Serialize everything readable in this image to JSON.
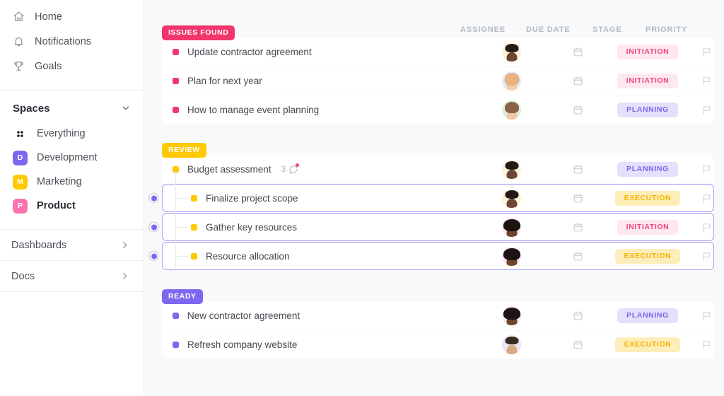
{
  "sidebar": {
    "nav": [
      {
        "label": "Home",
        "icon": "home-icon"
      },
      {
        "label": "Notifications",
        "icon": "bell-icon"
      },
      {
        "label": "Goals",
        "icon": "trophy-icon"
      }
    ],
    "spaces_header": {
      "label": "Spaces",
      "icon": "chevron-down-icon"
    },
    "spaces": [
      {
        "label": "Everything",
        "icon": "grid-dots-icon",
        "initial": "",
        "color": ""
      },
      {
        "label": "Development",
        "icon": "space-avatar",
        "initial": "D",
        "color": "#7b68ee"
      },
      {
        "label": "Marketing",
        "icon": "space-avatar",
        "initial": "M",
        "color": "#ffc800"
      },
      {
        "label": "Product",
        "icon": "space-avatar",
        "initial": "P",
        "color": "#fd71af",
        "active": true
      }
    ],
    "sections": [
      {
        "label": "Dashboards",
        "icon": "chevron-right-icon"
      },
      {
        "label": "Docs",
        "icon": "chevron-right-icon"
      }
    ]
  },
  "columns": {
    "assignee": "ASSIGNEE",
    "due_date": "DUE DATE",
    "stage": "STAGE",
    "priority": "PRIORITY"
  },
  "stage_colors": {
    "INITIATION": {
      "bg": "#fde8ef",
      "fg": "#f0467f"
    },
    "PLANNING": {
      "bg": "#e3e0fb",
      "fg": "#7b68ee"
    },
    "EXECUTION": {
      "bg": "#fdeeb9",
      "fg": "#f5b400"
    }
  },
  "groups": [
    {
      "name": "ISSUES FOUND",
      "badge_bg": "#f2366c",
      "bullet": "#f2366c",
      "tasks": [
        {
          "name": "Update contractor agreement",
          "stage": "INITIATION",
          "avatar": {
            "ring": "#fdf3d9",
            "skin": "#6d4733",
            "hair": "#241a16",
            "hw": 19,
            "hh": 12
          }
        },
        {
          "name": "Plan for next year",
          "stage": "INITIATION",
          "avatar": {
            "ring": "#dbeefb",
            "skin": "#f2cdb2",
            "hair": "#e8b37e",
            "hw": 21,
            "hh": 18
          }
        },
        {
          "name": "How to manage event planning",
          "stage": "PLANNING",
          "avatar": {
            "ring": "#dcf0e1",
            "skin": "#f0c6a8",
            "hair": "#8c6246",
            "hw": 20,
            "hh": 16
          }
        }
      ]
    },
    {
      "name": "REVIEW",
      "badge_bg": "#ffc800",
      "bullet": "#ffc800",
      "tasks": [
        {
          "name": "Budget assessment",
          "stage": "PLANNING",
          "comments": "3",
          "comment_badge": true,
          "avatar": {
            "ring": "#fdf3d9",
            "skin": "#6d4733",
            "hair": "#241a16",
            "hw": 19,
            "hh": 12
          }
        },
        {
          "name": "Finalize project scope",
          "stage": "EXECUTION",
          "subtask": true,
          "selected": true,
          "avatar": {
            "ring": "#fdf3d9",
            "skin": "#6d4733",
            "hair": "#241a16",
            "hw": 19,
            "hh": 12
          }
        },
        {
          "name": "Gather key resources",
          "stage": "INITIATION",
          "subtask": true,
          "selected": true,
          "avatar": {
            "ring": "#fbe4ec",
            "skin": "#70432c",
            "hair": "#1b1412",
            "hw": 24,
            "hh": 17
          }
        },
        {
          "name": "Resource allocation",
          "stage": "EXECUTION",
          "subtask": true,
          "selected": true,
          "avatar": {
            "ring": "#fbe4ec",
            "skin": "#70432c",
            "hair": "#1b1412",
            "hw": 24,
            "hh": 17
          }
        }
      ]
    },
    {
      "name": "READY",
      "badge_bg": "#7b68ee",
      "bullet": "#7b68ee",
      "tasks": [
        {
          "name": "New contractor agreement",
          "stage": "PLANNING",
          "avatar": {
            "ring": "#fbe4ec",
            "skin": "#70432c",
            "hair": "#1b1412",
            "hw": 24,
            "hh": 17
          }
        },
        {
          "name": "Refresh company website",
          "stage": "EXECUTION",
          "avatar": {
            "ring": "#e9e6f7",
            "skin": "#d8a882",
            "hair": "#3a2a20",
            "hw": 19,
            "hh": 11
          }
        }
      ]
    }
  ]
}
